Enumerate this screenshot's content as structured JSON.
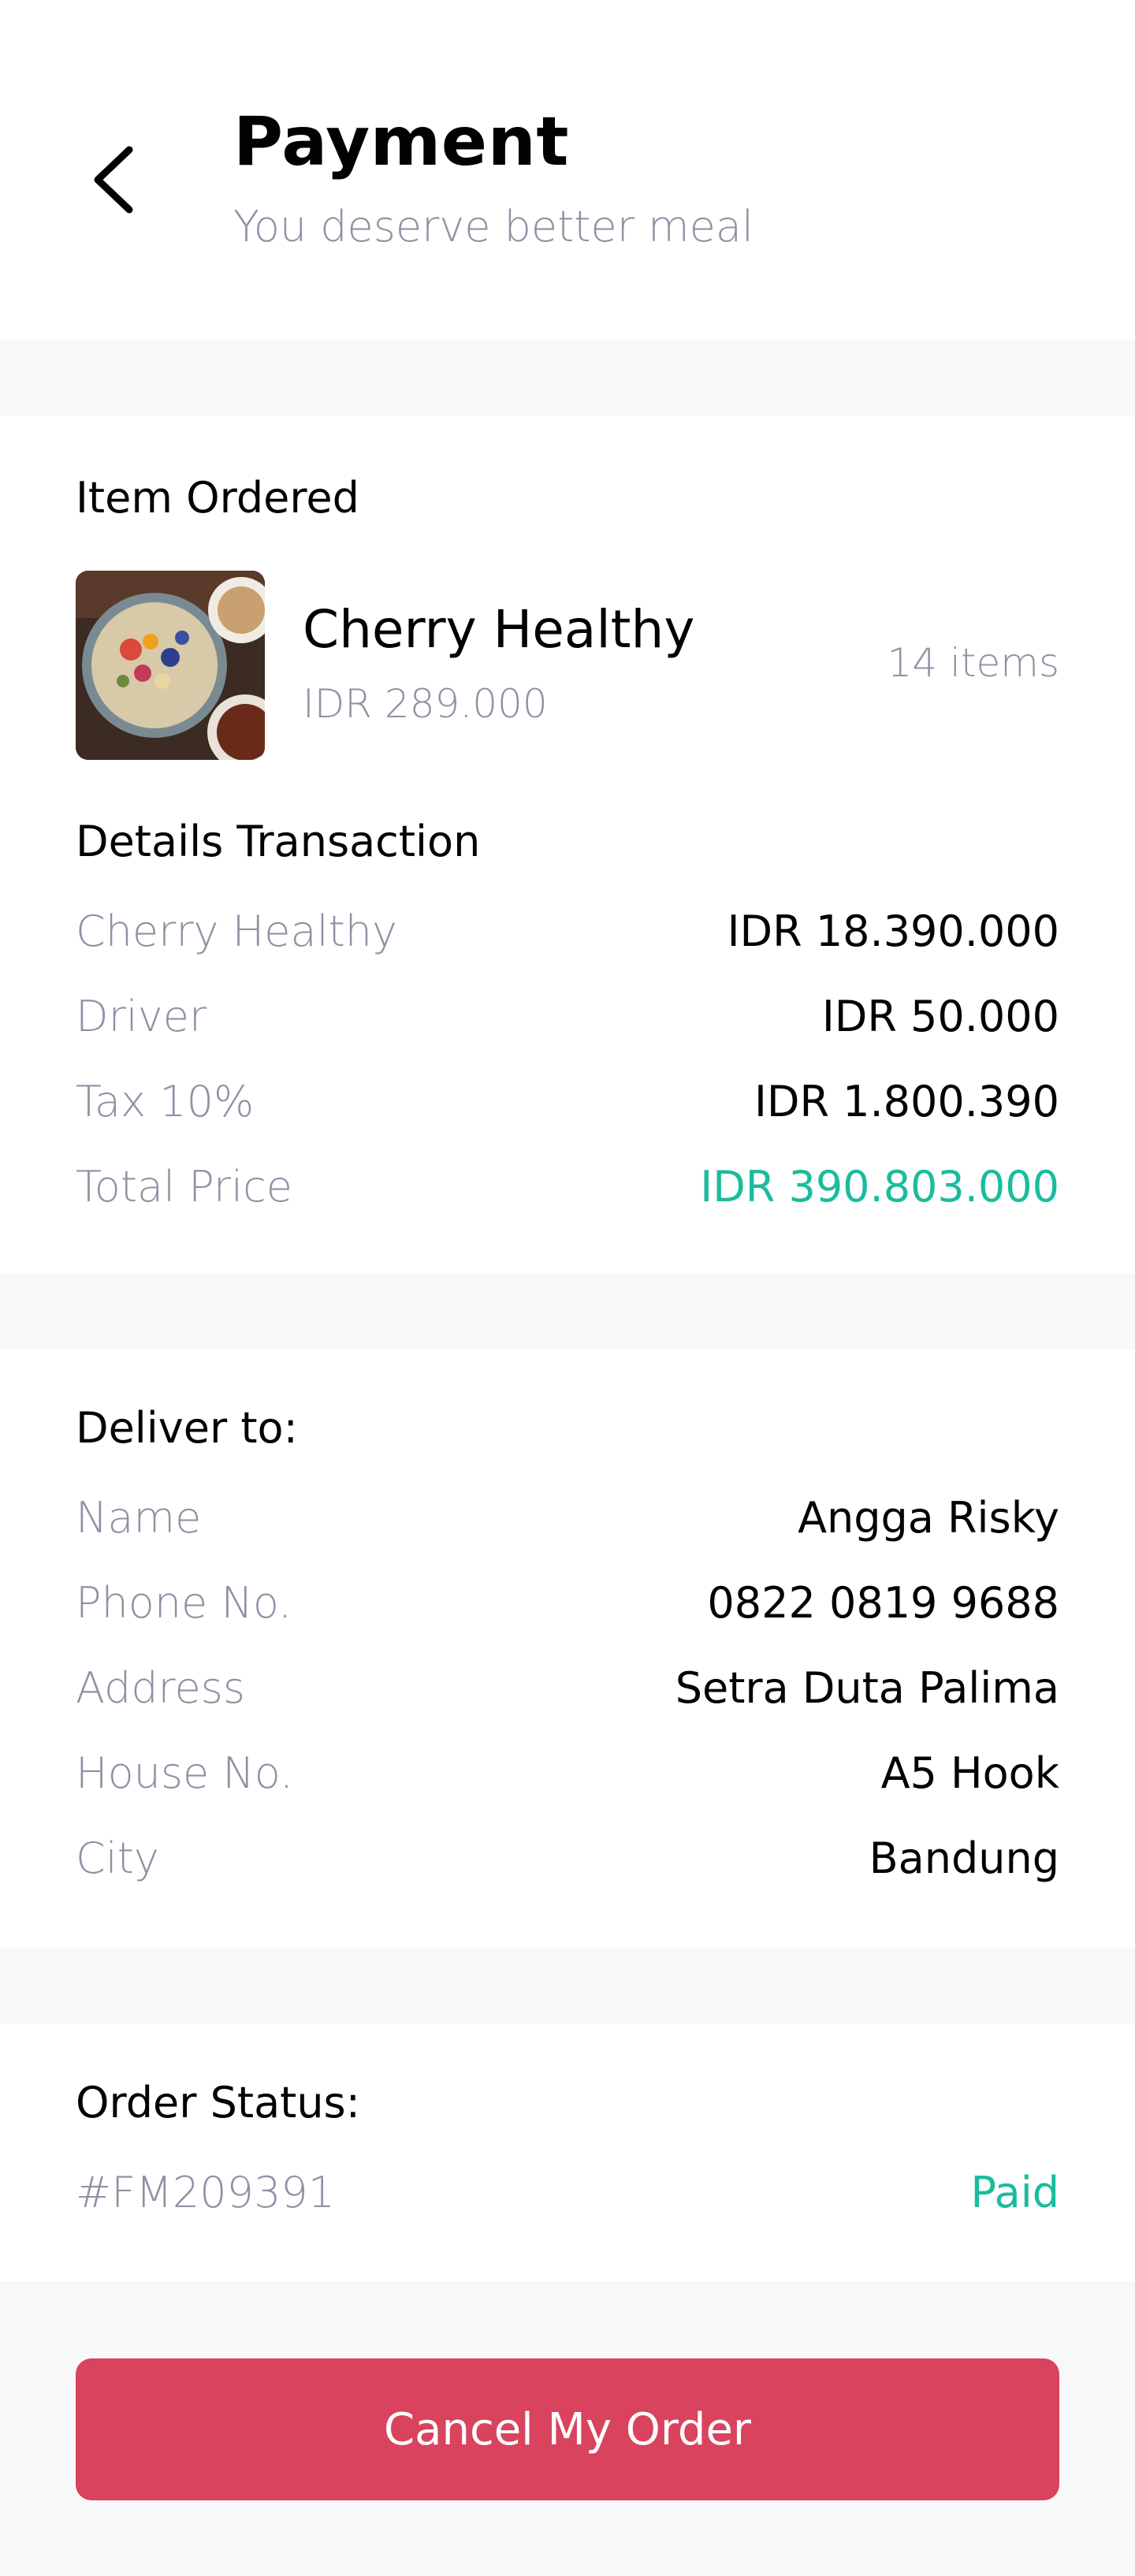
{
  "header": {
    "title": "Payment",
    "subtitle": "You deserve better meal",
    "back_icon": "chevron-left-icon"
  },
  "item_ordered": {
    "section_title": "Item Ordered",
    "item": {
      "name": "Cherry Healthy",
      "price": "IDR 289.000",
      "count": "14 items",
      "image": "food-bowl-image"
    }
  },
  "details_transaction": {
    "section_title": "Details Transaction",
    "rows": [
      {
        "label": "Cherry Healthy",
        "value": "IDR 18.390.000"
      },
      {
        "label": "Driver",
        "value": "IDR 50.000"
      },
      {
        "label": "Tax 10%",
        "value": "IDR 1.800.390"
      },
      {
        "label": "Total Price",
        "value": "IDR 390.803.000"
      }
    ]
  },
  "deliver_to": {
    "section_title": "Deliver to:",
    "rows": [
      {
        "label": "Name",
        "value": "Angga Risky"
      },
      {
        "label": "Phone No.",
        "value": "0822 0819 9688"
      },
      {
        "label": "Address",
        "value": "Setra Duta Palima"
      },
      {
        "label": "House No.",
        "value": "A5 Hook"
      },
      {
        "label": "City",
        "value": "Bandung"
      }
    ]
  },
  "order_status": {
    "section_title": "Order Status:",
    "order_id": "#FM209391",
    "status": "Paid"
  },
  "actions": {
    "cancel_label": "Cancel My Order"
  },
  "colors": {
    "accent_green": "#1ABC9C",
    "cancel_red": "#D9435E",
    "muted_text": "#8D92A3",
    "page_background": "#F8F8FB"
  }
}
